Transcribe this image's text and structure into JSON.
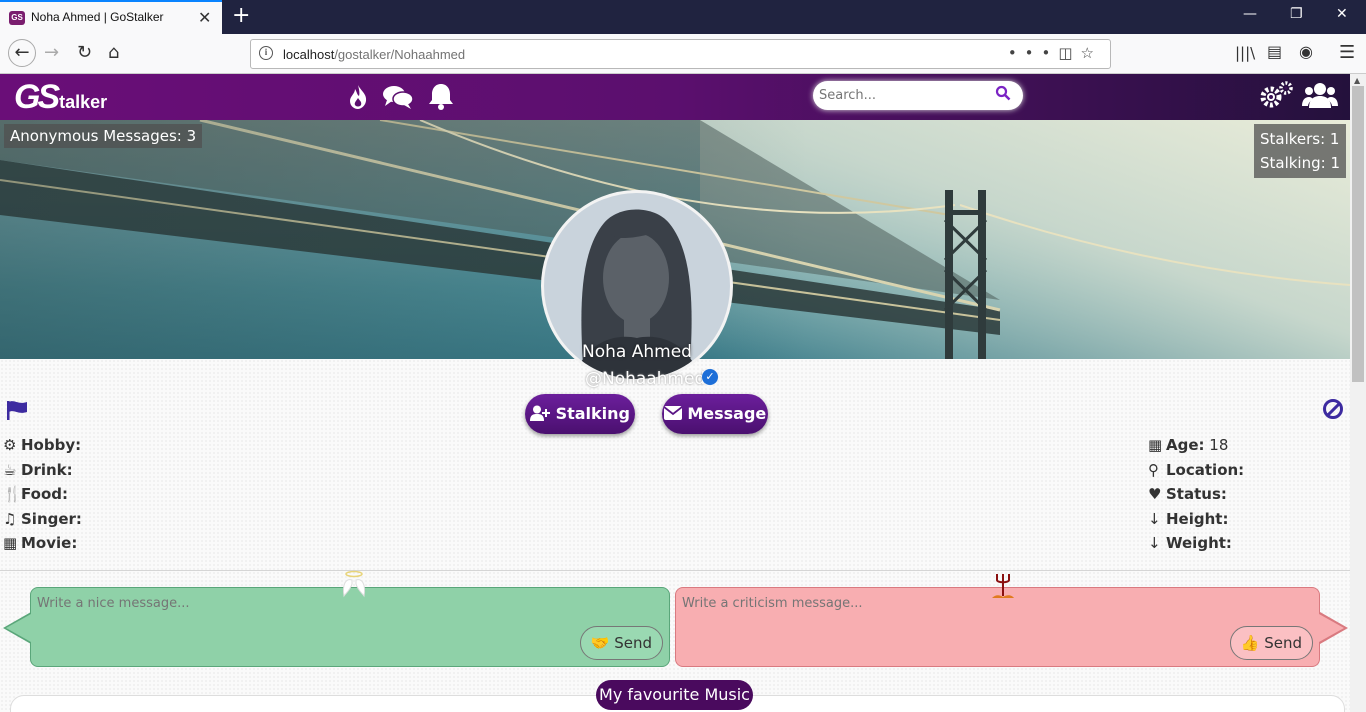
{
  "browser": {
    "tab_title": "Noha Ahmed | GoStalker",
    "tab_favicon_text": "GS",
    "url_host": "localhost",
    "url_path": "/gostalker/Nohaahmed"
  },
  "header": {
    "logo_main": "GS",
    "logo_sub": "talker",
    "search_placeholder": "Search..."
  },
  "cover": {
    "anonymous_messages": "Anonymous Messages: 3",
    "stalkers": "Stalkers: 1",
    "stalking": "Stalking: 1"
  },
  "profile": {
    "name": "Noha Ahmed",
    "handle": "@Nohaahmed",
    "stalking_button": "Stalking",
    "message_button": "Message"
  },
  "left_info": [
    {
      "label": "Hobby:",
      "icon": "puzzle-icon",
      "value": ""
    },
    {
      "label": "Drink:",
      "icon": "coffee-icon",
      "value": ""
    },
    {
      "label": "Food:",
      "icon": "utensils-icon",
      "value": ""
    },
    {
      "label": "Singer:",
      "icon": "headphones-icon",
      "value": ""
    },
    {
      "label": "Movie:",
      "icon": "film-icon",
      "value": ""
    }
  ],
  "right_info": [
    {
      "label": "Age:",
      "icon": "calendar-icon",
      "value": " 18"
    },
    {
      "label": "Location:",
      "icon": "map-marker-icon",
      "value": ""
    },
    {
      "label": "Status:",
      "icon": "heart-icon",
      "value": ""
    },
    {
      "label": "Height:",
      "icon": "sort-numeric-icon",
      "value": ""
    },
    {
      "label": "Weight:",
      "icon": "sort-amount-icon",
      "value": ""
    }
  ],
  "messages": {
    "nice_placeholder": "Write a nice message...",
    "criticism_placeholder": "Write a criticism message...",
    "send_label": "Send"
  },
  "sections": {
    "music_title": "My favourite Music"
  },
  "colors": {
    "brand_purple": "#6a0e78",
    "nice_green": "#8fd1a8",
    "critic_pink": "#f8aeb1"
  }
}
